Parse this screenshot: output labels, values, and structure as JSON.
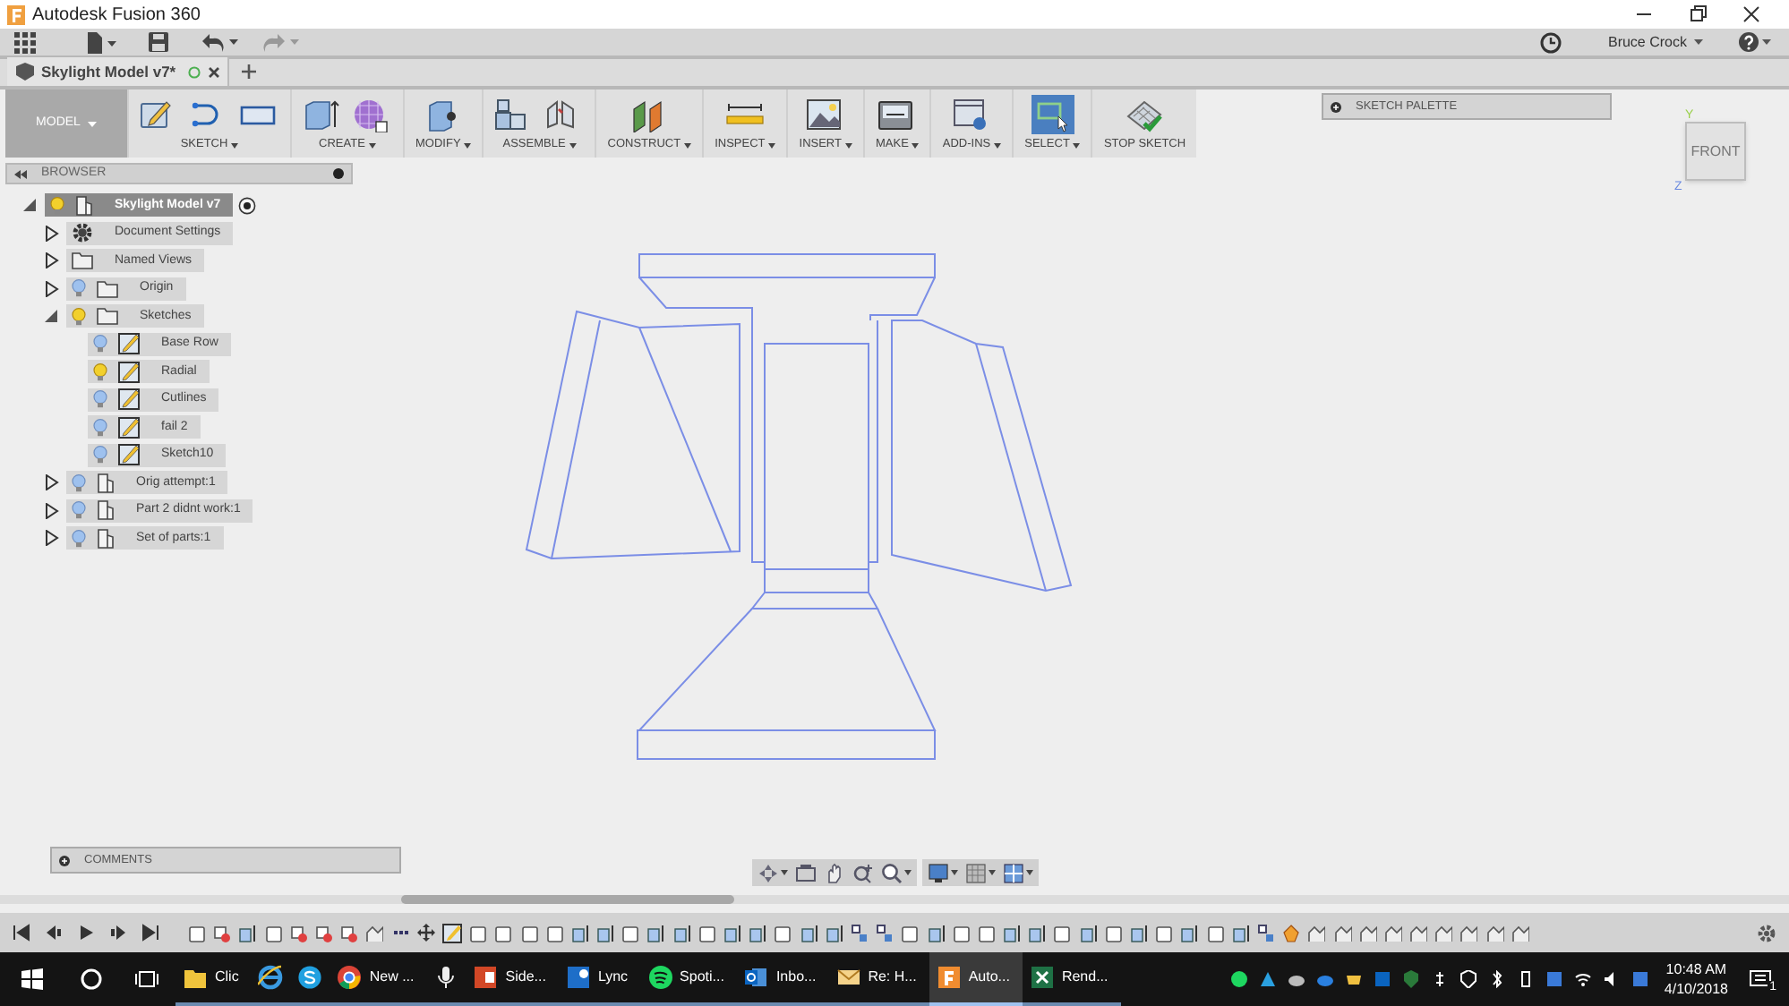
{
  "window": {
    "title": "Autodesk Fusion 360"
  },
  "user": {
    "name": "Bruce Crock"
  },
  "document_tab": {
    "title": "Skylight Model v7*"
  },
  "toolbar": {
    "mode": "MODEL",
    "groups": [
      {
        "kind": "sketch",
        "label": "SKETCH",
        "menu": true,
        "selected": false
      },
      {
        "kind": "create",
        "label": "CREATE",
        "menu": true,
        "selected": false
      },
      {
        "kind": "modify",
        "label": "MODIFY",
        "menu": true,
        "selected": false
      },
      {
        "kind": "assemble",
        "label": "ASSEMBLE",
        "menu": true,
        "selected": false
      },
      {
        "kind": "construct",
        "label": "CONSTRUCT",
        "menu": true,
        "selected": false
      },
      {
        "kind": "inspect",
        "label": "INSPECT",
        "menu": true,
        "selected": false
      },
      {
        "kind": "insert",
        "label": "INSERT",
        "menu": true,
        "selected": false
      },
      {
        "kind": "make",
        "label": "MAKE",
        "menu": true,
        "selected": false
      },
      {
        "kind": "addins",
        "label": "ADD-INS",
        "menu": true,
        "selected": false
      },
      {
        "kind": "select",
        "label": "SELECT",
        "menu": true,
        "selected": true
      },
      {
        "kind": "stop",
        "label": "STOP SKETCH",
        "menu": false,
        "selected": false
      }
    ]
  },
  "sketch_palette": {
    "title": "SKETCH PALETTE"
  },
  "view_cube": {
    "face": "FRONT",
    "axis_y": "Y",
    "axis_z": "Z"
  },
  "browser": {
    "title": "BROWSER",
    "tree": [
      {
        "label": "Skylight Model v7",
        "kind": "component",
        "visible": true,
        "expanded": true,
        "selected": true,
        "activated": true,
        "children": [
          {
            "label": "Document Settings",
            "kind": "settings",
            "expanded": false,
            "selected": false
          },
          {
            "label": "Named Views",
            "kind": "folder",
            "expanded": false,
            "selected": false
          },
          {
            "label": "Origin",
            "kind": "folder",
            "visible": false,
            "expanded": false,
            "selected": false
          },
          {
            "label": "Sketches",
            "kind": "folder",
            "visible": true,
            "expanded": true,
            "selected": false,
            "children": [
              {
                "label": "Base Row",
                "kind": "sketch",
                "visible": false,
                "selected": false
              },
              {
                "label": "Radial",
                "kind": "sketch",
                "visible": true,
                "selected": false
              },
              {
                "label": "Cutlines",
                "kind": "sketch",
                "visible": false,
                "selected": false
              },
              {
                "label": "fail 2",
                "kind": "sketch",
                "visible": false,
                "selected": false
              },
              {
                "label": "Sketch10",
                "kind": "sketch",
                "visible": false,
                "selected": false
              }
            ]
          },
          {
            "label": "Orig attempt:1",
            "kind": "component",
            "visible": false,
            "expanded": false,
            "selected": false
          },
          {
            "label": "Part 2 didnt work:1",
            "kind": "component",
            "visible": false,
            "expanded": false,
            "selected": false
          },
          {
            "label": "Set of parts:1",
            "kind": "component",
            "visible": false,
            "expanded": false,
            "selected": false
          }
        ]
      }
    ]
  },
  "comments": {
    "title": "COMMENTS"
  },
  "taskbar": {
    "items": [
      {
        "kind": "explorer",
        "label": "Clic",
        "active": false
      },
      {
        "kind": "ie",
        "active": false
      },
      {
        "kind": "skype",
        "active": false
      },
      {
        "kind": "chrome",
        "label": "New ...",
        "active": false
      },
      {
        "kind": "mic",
        "active": false
      },
      {
        "kind": "powerpoint",
        "label": "Side...",
        "active": false
      },
      {
        "kind": "lync",
        "label": "Lync",
        "active": false
      },
      {
        "kind": "spotify",
        "label": "Spoti...",
        "active": false
      },
      {
        "kind": "outlook",
        "label": "Inbo...",
        "active": false
      },
      {
        "kind": "mail",
        "label": "Re: H...",
        "active": false
      },
      {
        "kind": "fusion",
        "label": "Auto...",
        "active": true
      },
      {
        "kind": "excel",
        "label": "Rend...",
        "active": false
      }
    ],
    "time": "10:48 AM",
    "date": "4/10/2018",
    "notifications": "1"
  }
}
